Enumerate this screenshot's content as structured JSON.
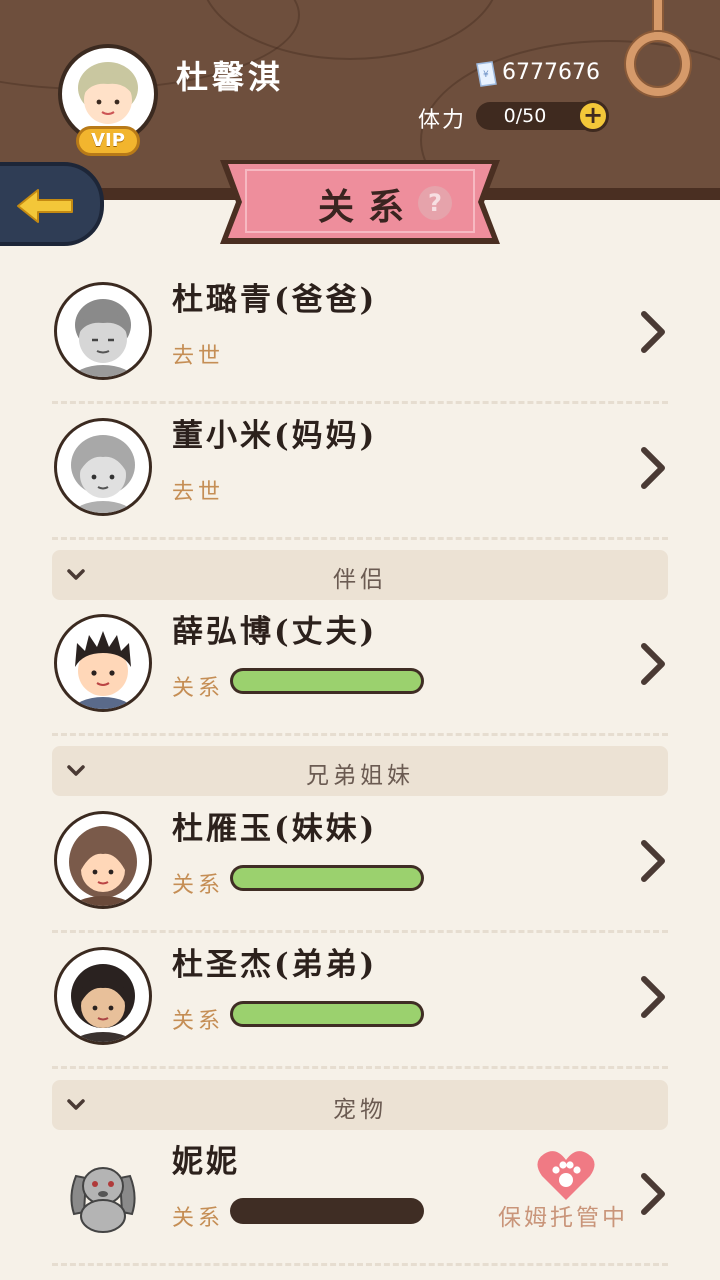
{
  "header": {
    "user_name": "杜馨淇",
    "vip_label": "VIP",
    "money": "6777676",
    "stamina_label": "体力",
    "stamina_value": "0/50",
    "stamina_plus": "+",
    "title": "关系",
    "help": "?"
  },
  "family": [
    {
      "name": "杜璐青(爸爸)",
      "status": "去世"
    },
    {
      "name": "董小米(妈妈)",
      "status": "去世"
    }
  ],
  "sections": [
    {
      "label": "伴侣",
      "members": [
        {
          "name": "薛弘博(丈夫)",
          "relation_label": "关系",
          "relation_level": 1.0
        }
      ]
    },
    {
      "label": "兄弟姐妹",
      "members": [
        {
          "name": "杜雁玉(妹妹)",
          "relation_label": "关系",
          "relation_level": 1.0
        },
        {
          "name": "杜圣杰(弟弟)",
          "relation_label": "关系",
          "relation_level": 1.0
        }
      ]
    },
    {
      "label": "宠物",
      "members": [
        {
          "name": "妮妮",
          "relation_label": "关系",
          "relation_level": 0.0,
          "status": "保姆托管中"
        }
      ]
    }
  ],
  "colors": {
    "wood": "#6e4f3d",
    "background": "#f6f1e8",
    "ribbon": "#ee8e9c",
    "relation_fill": "#9bd16e",
    "status_text": "#c58e55"
  },
  "icons": {
    "back": "back-arrow-icon",
    "chevron": "chevron-right-icon",
    "toggle": "chevron-down-icon",
    "money": "cash-icon",
    "help": "question-icon",
    "pet_status": "paw-heart-icon"
  }
}
